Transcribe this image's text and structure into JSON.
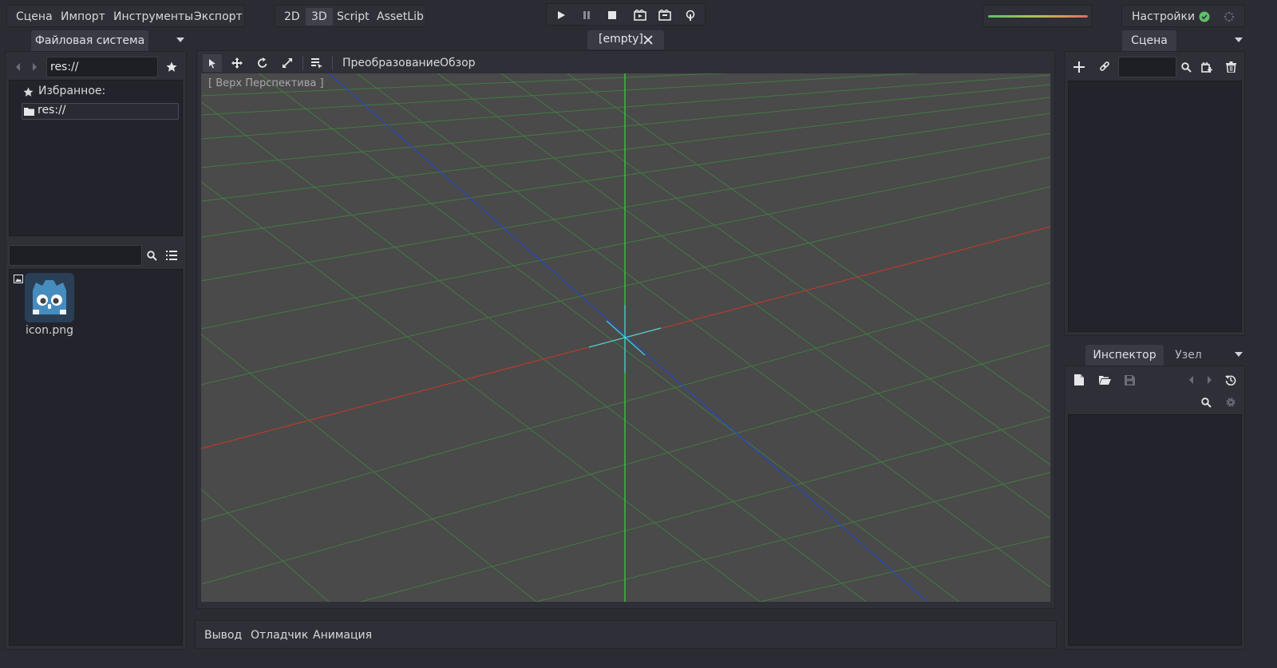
{
  "top_menu": {
    "items": [
      "Сцена",
      "Импорт",
      "Инструменты",
      "Экспорт"
    ]
  },
  "workspace": {
    "tabs": [
      "2D",
      "3D",
      "Script",
      "AssetLib"
    ],
    "active": "3D"
  },
  "play_controls": [
    "play-icon",
    "pause-icon",
    "stop-icon",
    "play-scene-icon",
    "play-custom-scene-icon",
    "remote-debug-icon"
  ],
  "settings": {
    "label": "Настройки"
  },
  "filesystem": {
    "tab_label": "Файловая система",
    "path_value": "res://",
    "favorites_label": "Избранное:",
    "root_label": "res://",
    "search_placeholder": "",
    "files": [
      {
        "name": "icon.png",
        "icon": "godot-icon"
      }
    ]
  },
  "editor": {
    "scene_tab": "[empty]"
  },
  "viewport": {
    "toolbar": {
      "transform_menu": "Преобразование",
      "view_menu": "Обзор"
    },
    "overlay_label": "[ Верх Перспектива ]",
    "colors": {
      "background": "#4a4a4a",
      "grid": "#3f8a3f",
      "axis_x": "#b03a2e",
      "axis_y": "#38d838",
      "axis_z": "#2a48b8",
      "gizmo": "#3fd6d6"
    }
  },
  "bottom_panel": {
    "tabs": [
      "Вывод",
      "Отладчик",
      "Анимация"
    ]
  },
  "scene_dock": {
    "tab_label": "Сцена"
  },
  "inspector_dock": {
    "tabs": [
      "Инспектор",
      "Узел"
    ]
  }
}
